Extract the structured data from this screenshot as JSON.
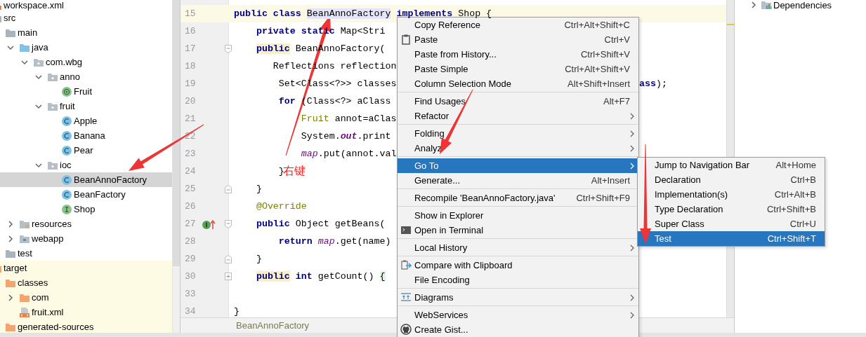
{
  "project_tree": {
    "items": [
      {
        "label": "workspace.xml",
        "kind": "xml-file",
        "selected": false
      },
      {
        "label": "src",
        "kind": "folder",
        "selected": false,
        "children": [
          {
            "label": "main",
            "kind": "folder",
            "selected": false,
            "children": [
              {
                "label": "java",
                "kind": "source-folder",
                "expanded": true,
                "selected": false,
                "children": [
                  {
                    "label": "com.wbg",
                    "kind": "package",
                    "expanded": true,
                    "selected": false,
                    "children": [
                      {
                        "label": "anno",
                        "kind": "package",
                        "expanded": true,
                        "selected": false,
                        "children": [
                          {
                            "label": "Fruit",
                            "kind": "annotation",
                            "selected": false
                          }
                        ]
                      },
                      {
                        "label": "fruit",
                        "kind": "package",
                        "expanded": true,
                        "selected": false,
                        "children": [
                          {
                            "label": "Apple",
                            "kind": "class",
                            "selected": false
                          },
                          {
                            "label": "Banana",
                            "kind": "class",
                            "selected": false
                          },
                          {
                            "label": "Pear",
                            "kind": "class",
                            "selected": false
                          }
                        ]
                      },
                      {
                        "label": "ioc",
                        "kind": "package",
                        "expanded": true,
                        "selected": false,
                        "children": [
                          {
                            "label": "BeanAnnoFactory",
                            "kind": "class",
                            "selected": true
                          },
                          {
                            "label": "BeanFactory",
                            "kind": "class",
                            "selected": false
                          },
                          {
                            "label": "Shop",
                            "kind": "interface",
                            "selected": false
                          }
                        ]
                      }
                    ]
                  }
                ]
              },
              {
                "label": "resources",
                "kind": "resources-folder",
                "expanded": false,
                "selected": false
              },
              {
                "label": "webapp",
                "kind": "web-folder",
                "expanded": false,
                "selected": false
              }
            ]
          },
          {
            "label": "test",
            "kind": "folder",
            "selected": false
          }
        ]
      },
      {
        "label": "target",
        "kind": "excluded-folder",
        "selected": false,
        "children": [
          {
            "label": "classes",
            "kind": "excluded-folder",
            "selected": false,
            "children": [
              {
                "label": "com",
                "kind": "excluded-folder",
                "expanded": false,
                "selected": false
              },
              {
                "label": "fruit.xml",
                "kind": "xml-file",
                "selected": false
              }
            ]
          },
          {
            "label": "generated-sources",
            "kind": "excluded-folder",
            "selected": false
          }
        ]
      }
    ]
  },
  "editor": {
    "lines": [
      {
        "number": "15",
        "current": true,
        "tokens": [
          {
            "text": "public class ",
            "kind": "keyword"
          },
          {
            "text": "BeanAnnoFactory",
            "kind": "marked-name"
          },
          {
            "text": " implements ",
            "kind": "keyword"
          },
          {
            "text": "Shop {",
            "kind": "plain"
          }
        ]
      },
      {
        "number": "16",
        "current": false,
        "tokens": [
          {
            "text": "    private static ",
            "kind": "keyword"
          },
          {
            "text": "Map<Stri",
            "kind": "plain"
          }
        ]
      },
      {
        "number": "17",
        "current": false,
        "fold_marker": {
          "kind": "start"
        },
        "tokens": [
          {
            "text": "    public",
            "kind": "marked-keyword"
          },
          {
            "text": " BeanAnnoFactory(",
            "kind": "plain"
          }
        ]
      },
      {
        "number": "18",
        "current": false,
        "tokens": [
          {
            "text": "       Reflections reflection",
            "kind": "plain"
          }
        ]
      },
      {
        "number": "19",
        "current": false,
        "tokens": [
          {
            "text": "        Set<Class<?>> classes",
            "kind": "plain"
          }
        ],
        "tail": [
          {
            "text": "ass",
            "kind": "keyword"
          },
          {
            "text": ");",
            "kind": "plain"
          }
        ]
      },
      {
        "number": "20",
        "current": false,
        "tokens": [
          {
            "text": "        for",
            "kind": "keyword"
          },
          {
            "text": " (Class<?> aClass",
            "kind": "plain"
          }
        ]
      },
      {
        "number": "21",
        "current": false,
        "tokens": [
          {
            "text": "            Fruit",
            "kind": "type"
          },
          {
            "text": " annot=aClas",
            "kind": "plain"
          }
        ]
      },
      {
        "number": "22",
        "current": false,
        "tokens": [
          {
            "text": "            System.",
            "kind": "plain"
          },
          {
            "text": "out",
            "kind": "static-field"
          },
          {
            "text": ".print",
            "kind": "plain"
          }
        ]
      },
      {
        "number": "23",
        "current": false,
        "tokens": [
          {
            "text": "            map",
            "kind": "field"
          },
          {
            "text": ".put(annot.val",
            "kind": "plain"
          }
        ]
      },
      {
        "number": "24",
        "current": false,
        "tokens": [
          {
            "text": "        }",
            "kind": "plain"
          }
        ],
        "note": "右键"
      },
      {
        "number": "25",
        "current": false,
        "fold_marker": {
          "kind": "end"
        },
        "tokens": [
          {
            "text": "    }",
            "kind": "plain"
          }
        ]
      },
      {
        "number": "26",
        "current": false,
        "tokens": [
          {
            "text": "    @Override",
            "kind": "type"
          }
        ]
      },
      {
        "number": "27",
        "current": false,
        "fold_marker": {
          "kind": "start"
        },
        "gutter_marker": {
          "kind": "implements"
        },
        "tokens": [
          {
            "text": "    public",
            "kind": "keyword"
          },
          {
            "text": " Object getBeans(",
            "kind": "plain"
          }
        ]
      },
      {
        "number": "28",
        "current": false,
        "tokens": [
          {
            "text": "        return",
            "kind": "keyword"
          },
          {
            "text": " map",
            "kind": "field"
          },
          {
            "text": ".get(name)",
            "kind": "plain"
          }
        ]
      },
      {
        "number": "29",
        "current": false,
        "fold_marker": {
          "kind": "end"
        },
        "tokens": [
          {
            "text": "    }",
            "kind": "plain"
          }
        ]
      },
      {
        "number": "30",
        "current": false,
        "fold_marker": {
          "kind": "collapsed"
        },
        "tokens": [
          {
            "text": "    public",
            "kind": "marked-keyword"
          },
          {
            "text": " int",
            "kind": "keyword"
          },
          {
            "text": " getCount() ",
            "kind": "plain"
          },
          {
            "text": "{",
            "kind": "marked-brace"
          }
        ]
      },
      {
        "number": "33",
        "current": false
      },
      {
        "number": "34",
        "current": false,
        "tokens": [
          {
            "text": "}",
            "kind": "plain"
          }
        ]
      }
    ],
    "breadcrumb": "BeanAnnoFactory"
  },
  "side_panel": {
    "items": [
      {
        "label": "Dependencies",
        "expanded": false
      }
    ]
  },
  "context_menu": {
    "groups": [
      [
        {
          "label": "Copy Reference",
          "shortcut": "Ctrl+Alt+Shift+C",
          "submenu": false,
          "selected": false
        },
        {
          "label": "Paste",
          "shortcut": "Ctrl+V",
          "kind": "clipboard",
          "submenu": false,
          "selected": false
        },
        {
          "label": "Paste from History...",
          "shortcut": "Ctrl+Shift+V",
          "submenu": false,
          "selected": false
        },
        {
          "label": "Paste Simple",
          "shortcut": "Ctrl+Alt+Shift+V",
          "submenu": false,
          "selected": false
        },
        {
          "label": "Column Selection Mode",
          "shortcut": "Alt+Shift+Insert",
          "submenu": false,
          "selected": false
        }
      ],
      [
        {
          "label": "Find Usages",
          "shortcut": "Alt+F7",
          "submenu": false,
          "selected": false
        },
        {
          "label": "Refactor",
          "submenu": true,
          "selected": false
        }
      ],
      [
        {
          "label": "Folding",
          "submenu": true,
          "selected": false
        },
        {
          "label": "Analyz",
          "submenu": true,
          "selected": false
        }
      ],
      [
        {
          "label": "Go To",
          "submenu": true,
          "selected": true
        },
        {
          "label": "Generate...",
          "shortcut": "Alt+Insert",
          "submenu": false,
          "selected": false
        }
      ],
      [
        {
          "label": "Recompile 'BeanAnnoFactory.java'",
          "shortcut": "Ctrl+Shift+F9",
          "submenu": false,
          "selected": false
        }
      ],
      [
        {
          "label": "Show in Explorer",
          "submenu": false,
          "selected": false
        },
        {
          "label": "Open in Terminal",
          "kind": "terminal",
          "submenu": false,
          "selected": false
        }
      ],
      [
        {
          "label": "Local History",
          "submenu": true,
          "selected": false
        }
      ],
      [
        {
          "label": "Compare with Clipboard",
          "kind": "compare",
          "submenu": false,
          "selected": false
        },
        {
          "label": "File Encoding",
          "submenu": false,
          "selected": false
        }
      ],
      [
        {
          "label": "Diagrams",
          "kind": "diagram",
          "submenu": true,
          "selected": false
        }
      ],
      [
        {
          "label": "WebServices",
          "submenu": true,
          "selected": false
        },
        {
          "label": "Create Gist...",
          "kind": "gist",
          "submenu": false,
          "selected": false
        }
      ]
    ]
  },
  "submenu": {
    "groups": [
      [
        {
          "label": "Jump to Navigation Bar",
          "shortcut": "Alt+Home",
          "submenu": false,
          "selected": false
        },
        {
          "label": "Declaration",
          "shortcut": "Ctrl+B",
          "submenu": false,
          "selected": false
        },
        {
          "label": "Implementation(s)",
          "shortcut": "Ctrl+Alt+B",
          "submenu": false,
          "selected": false
        },
        {
          "label": "Type Declaration",
          "shortcut": "Ctrl+Shift+B",
          "submenu": false,
          "selected": false
        },
        {
          "label": "Super Class",
          "shortcut": "Ctrl+U",
          "submenu": false,
          "selected": false
        },
        {
          "label": "Test",
          "shortcut": "Ctrl+Shift+T",
          "submenu": false,
          "selected": true
        }
      ]
    ]
  }
}
